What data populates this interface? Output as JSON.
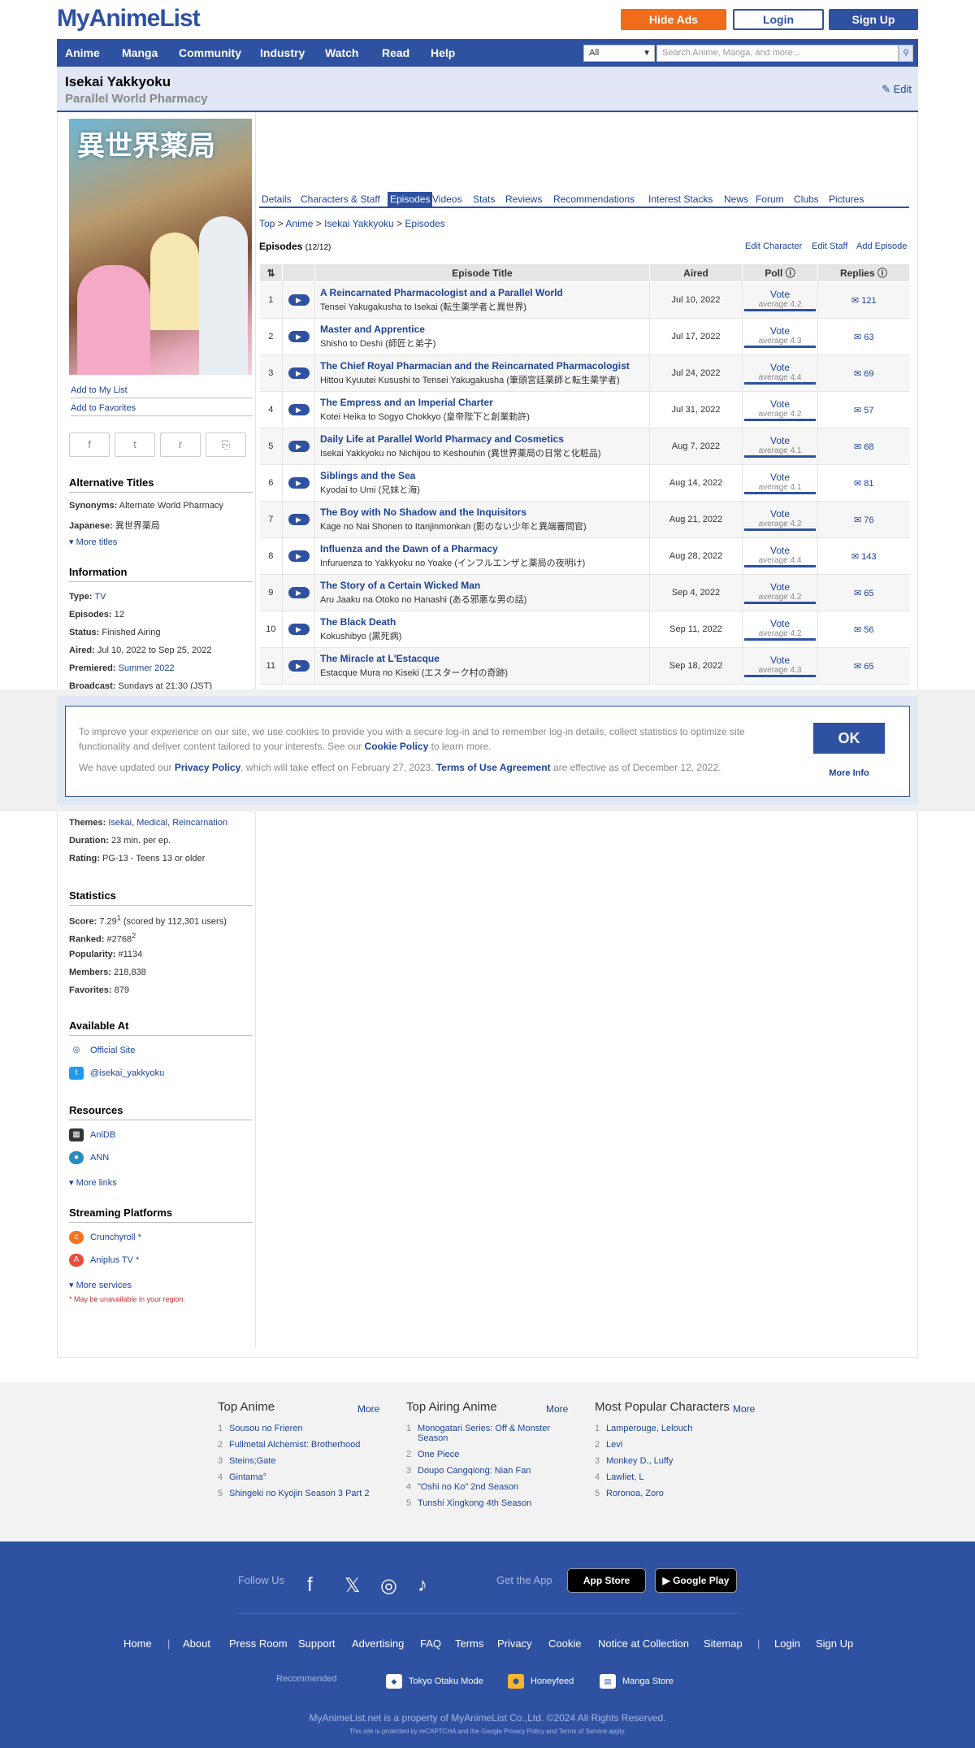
{
  "topbar": {
    "logo": "MyAnimeList",
    "hide_ads": "Hide Ads",
    "login": "Login",
    "signup": "Sign Up"
  },
  "nav": {
    "items": [
      "Anime",
      "Manga",
      "Community",
      "Industry",
      "Watch",
      "Read",
      "Help"
    ],
    "search_select": "All",
    "search_placeholder": "Search Anime, Manga, and more...",
    "search_icon": "search-icon"
  },
  "header": {
    "title": "Isekai Yakkyoku",
    "subtitle": "Parallel World Pharmacy",
    "edit": "Edit"
  },
  "sidebar": {
    "add_list": "Add to My List",
    "add_fav": "Add to Favorites",
    "alt_titles_head": "Alternative Titles",
    "synonyms_label": "Synonyms:",
    "synonyms": "Alternate World Pharmacy",
    "japanese_label": "Japanese:",
    "japanese": "異世界薬局",
    "more_titles": "More titles",
    "info_head": "Information",
    "type_label": "Type:",
    "type": "TV",
    "episodes_label": "Episodes:",
    "episodes": "12",
    "status_label": "Status:",
    "status": "Finished Airing",
    "aired_label": "Aired:",
    "aired": "Jul 10, 2022 to Sep 25, 2022",
    "premiered_label": "Premiered:",
    "premiered": "Summer 2022",
    "broadcast_label": "Broadcast:",
    "broadcast": "Sundays at 21:30 (JST)",
    "themes_label": "Themes:",
    "themes": [
      "Isekai",
      "Medical",
      "Reincarnation"
    ],
    "duration_label": "Duration:",
    "duration": "23 min. per ep.",
    "rating_label": "Rating:",
    "rating": "PG-13 - Teens 13 or older",
    "stats_head": "Statistics",
    "score_label": "Score:",
    "score": "7.29",
    "score_sup": "1",
    "score_by": "(scored by 112,301 users)",
    "ranked_label": "Ranked:",
    "ranked": "#2768",
    "ranked_sup": "2",
    "popularity_label": "Popularity:",
    "popularity": "#1134",
    "members_label": "Members:",
    "members": "218,838",
    "favorites_label": "Favorites:",
    "favorites": "879",
    "available_head": "Available At",
    "official_site": "Official Site",
    "twitter": "@isekai_yakkyoku",
    "resources_head": "Resources",
    "anidb": "AniDB",
    "ann": "ANN",
    "more_links": "More links",
    "streaming_head": "Streaming Platforms",
    "crunchyroll": "Crunchyroll *",
    "aniplus": "Aniplus TV *",
    "more_services": "More services",
    "region_note": "*  May be unavailable in your region."
  },
  "tabs": [
    "Details",
    "Characters & Staff",
    "Episodes",
    "Videos",
    "Stats",
    "Reviews",
    "Recommendations",
    "Interest Stacks",
    "News",
    "Forum",
    "Clubs",
    "Pictures"
  ],
  "breadcrumb": {
    "top": "Top",
    "anime": "Anime",
    "title": "Isekai Yakkyoku",
    "page": "Episodes",
    "sep": ">"
  },
  "episodes_head": {
    "label": "Episodes",
    "count": "(12/12)",
    "edit_char": "Edit Character",
    "edit_staff": "Edit Staff",
    "add_ep": "Add Episode"
  },
  "table": {
    "h_title": "Episode Title",
    "h_aired": "Aired",
    "h_poll": "Poll",
    "h_replies": "Replies",
    "vote": "Vote",
    "rows": [
      {
        "n": "1",
        "en": "A Reincarnated Pharmacologist and a Parallel World",
        "jp": "Tensei Yakugakusha to Isekai (転生薬学者と異世界)",
        "aired": "Jul 10, 2022",
        "avg": "average 4.2",
        "rep": "121"
      },
      {
        "n": "2",
        "en": "Master and Apprentice",
        "jp": "Shisho to Deshi (師匠と弟子)",
        "aired": "Jul 17, 2022",
        "avg": "average 4.3",
        "rep": "63"
      },
      {
        "n": "3",
        "en": "The Chief Royal Pharmacian and the Reincarnated Pharmacologist",
        "jp": "Hittou Kyuutei Kusushi to Tensei Yakugakusha (筆頭宮廷薬師と転生薬学者)",
        "aired": "Jul 24, 2022",
        "avg": "average 4.4",
        "rep": "69"
      },
      {
        "n": "4",
        "en": "The Empress and an Imperial Charter",
        "jp": "Kotei Heika to Sogyo Chokkyo (皇帝陛下と創業勅許)",
        "aired": "Jul 31, 2022",
        "avg": "average 4.2",
        "rep": "57"
      },
      {
        "n": "5",
        "en": "Daily Life at Parallel World Pharmacy and Cosmetics",
        "jp": "Isekai Yakkyoku no Nichijou to Keshouhin (異世界薬局の日常と化粧品)",
        "aired": "Aug 7, 2022",
        "avg": "average 4.1",
        "rep": "68"
      },
      {
        "n": "6",
        "en": "Siblings and the Sea",
        "jp": "Kyodai to Umi (兄妹と海)",
        "aired": "Aug 14, 2022",
        "avg": "average 4.1",
        "rep": "81"
      },
      {
        "n": "7",
        "en": "The Boy with No Shadow and the Inquisitors",
        "jp": "Kage no Nai Shonen to Itanjinmonkan (影のない少年と異端審問官)",
        "aired": "Aug 21, 2022",
        "avg": "average 4.2",
        "rep": "76"
      },
      {
        "n": "8",
        "en": "Influenza and the Dawn of a Pharmacy",
        "jp": "Infuruenza to Yakkyoku no Yoake (インフルエンザと薬局の夜明け)",
        "aired": "Aug 28, 2022",
        "avg": "average 4.4",
        "rep": "143"
      },
      {
        "n": "9",
        "en": "The Story of a Certain Wicked Man",
        "jp": "Aru Jaaku na Otoko no Hanashi (ある邪悪な男の話)",
        "aired": "Sep 4, 2022",
        "avg": "average 4.2",
        "rep": "65"
      },
      {
        "n": "10",
        "en": "The Black Death",
        "jp": "Kokushibyo (黒死病)",
        "aired": "Sep 11, 2022",
        "avg": "average 4.2",
        "rep": "56"
      },
      {
        "n": "11",
        "en": "The Miracle at L'Estacque",
        "jp": "Estacque Mura no Kiseki (エスターク村の奇跡)",
        "aired": "Sep 18, 2022",
        "avg": "average 4.3",
        "rep": "65"
      }
    ]
  },
  "cookie": {
    "p1a": "To improve your experience on our site, we use cookies to provide you with a secure log-in and to remember log-in details, collect statistics to optimize site functionality and deliver content tailored to your interests. See our ",
    "cookie_policy": "Cookie Policy",
    "p1b": " to learn more.",
    "p2a": "We have updated our ",
    "privacy_policy": "Privacy Policy",
    "p2b": ", which will take effect on February 27, 2023. ",
    "tou": "Terms of Use Agreement",
    "p2c": " are effective as of December 12, 2022.",
    "ok": "OK",
    "more_info": "More Info"
  },
  "footer_lists": {
    "more": "More",
    "top_anime": {
      "head": "Top Anime",
      "items": [
        "Sousou no Frieren",
        "Fullmetal Alchemist: Brotherhood",
        "Steins;Gate",
        "Gintama°",
        "Shingeki no Kyojin Season 3 Part 2"
      ]
    },
    "top_airing": {
      "head": "Top Airing Anime",
      "items": [
        "Monogatari Series: Off & Monster Season",
        "One Piece",
        "Doupo Cangqiong: Nian Fan",
        "\"Oshi no Ko\" 2nd Season",
        "Tunshi Xingkong 4th Season"
      ]
    },
    "popular_chars": {
      "head": "Most Popular Characters",
      "items": [
        "Lamperouge, Lelouch",
        "Levi",
        "Monkey D., Luffy",
        "Lawliet, L",
        "Roronoa, Zoro"
      ]
    }
  },
  "footer": {
    "follow": "Follow Us",
    "get_app": "Get the App",
    "app_store": "App Store",
    "google_play": "Google Play",
    "links": [
      "Home",
      "About",
      "Press Room",
      "Support",
      "Advertising",
      "FAQ",
      "Terms",
      "Privacy",
      "Cookie",
      "Notice at Collection",
      "Sitemap"
    ],
    "login": "Login",
    "signup": "Sign Up",
    "recommended": "Recommended",
    "rec": [
      "Tokyo Otaku Mode",
      "Honeyfeed",
      "Manga Store"
    ],
    "copyright": "MyAnimeList.net is a property of MyAnimeList Co.,Ltd. ©2024 All Rights Reserved.",
    "recaptcha": "This site is protected by reCAPTCHA and the Google Privacy Policy and Terms of Service apply."
  },
  "colors": {
    "brand": "#2e51a2",
    "accent": "#f06b1a",
    "link": "#1c439b"
  }
}
